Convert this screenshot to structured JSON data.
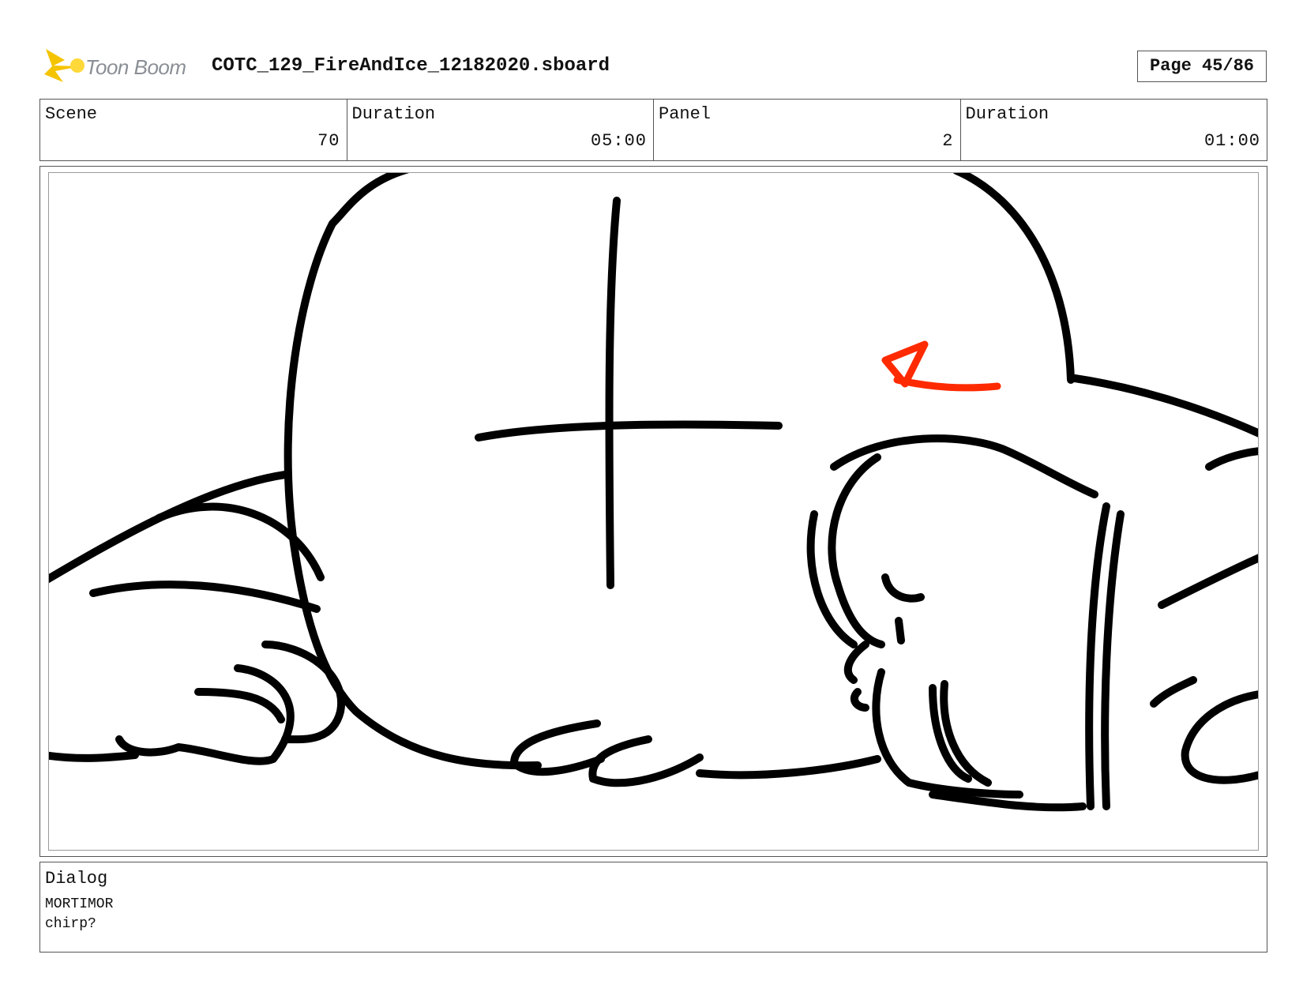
{
  "header": {
    "logo_text": "Toon Boom",
    "file_name": "COTC_129_FireAndIce_12182020.sboard",
    "page_label": "Page 45/86"
  },
  "info": {
    "scene_label": "Scene",
    "scene_value": "70",
    "scene_duration_label": "Duration",
    "scene_duration_value": "05:00",
    "panel_label": "Panel",
    "panel_value": "2",
    "panel_duration_label": "Duration",
    "panel_duration_value": "01:00"
  },
  "panel": {
    "line_color": "#000000",
    "annotation_color": "#ff2a00"
  },
  "dialog": {
    "label": "Dialog",
    "speaker": "MORTIMOR",
    "text": "chirp?"
  },
  "colors": {
    "logo_accent": "#f5c400",
    "logo_text": "#8a8f95"
  }
}
